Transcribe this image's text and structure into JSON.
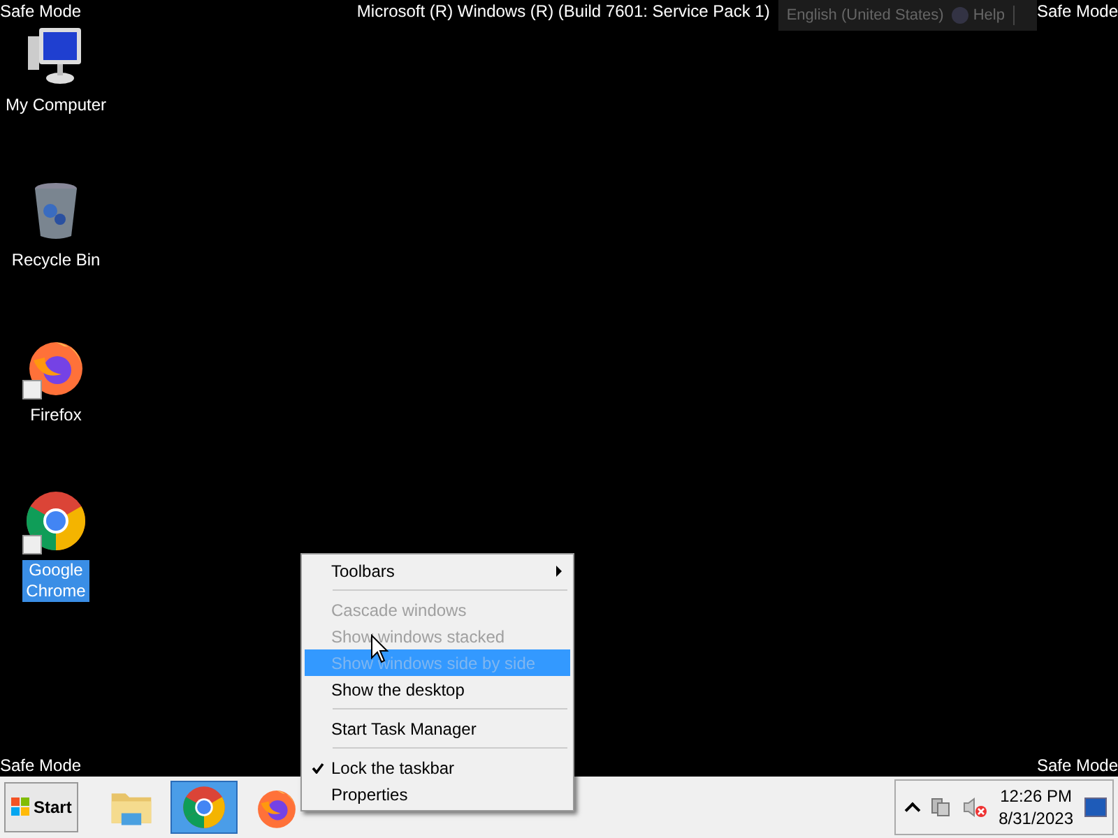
{
  "top_bar": {
    "left_label": "Safe Mode",
    "title": "Microsoft (R) Windows (R) (Build 7601: Service Pack 1)",
    "language": "English (United States)",
    "help": "Help",
    "right_label": "Safe Mode"
  },
  "desktop_icons": [
    {
      "kind": "computer",
      "label": "My Computer",
      "selected": false,
      "shortcut": false
    },
    {
      "kind": "recycle",
      "label": "Recycle Bin",
      "selected": false,
      "shortcut": false
    },
    {
      "kind": "firefox",
      "label": "Firefox",
      "selected": false,
      "shortcut": true
    },
    {
      "kind": "chrome",
      "label": "Google Chrome",
      "selected": true,
      "shortcut": true
    }
  ],
  "bottom_labels": {
    "left": "Safe Mode",
    "right": "Safe Mode"
  },
  "context_menu": [
    {
      "kind": "item",
      "label": "Toolbars",
      "disabled": false,
      "selected": false,
      "checked": false,
      "submenu": true
    },
    {
      "kind": "separator"
    },
    {
      "kind": "item",
      "label": "Cascade windows",
      "disabled": true,
      "selected": false,
      "checked": false,
      "submenu": false
    },
    {
      "kind": "item",
      "label": "Show windows stacked",
      "disabled": true,
      "selected": false,
      "checked": false,
      "submenu": false
    },
    {
      "kind": "item",
      "label": "Show windows side by side",
      "disabled": true,
      "selected": true,
      "checked": false,
      "submenu": false
    },
    {
      "kind": "item",
      "label": "Show the desktop",
      "disabled": false,
      "selected": false,
      "checked": false,
      "submenu": false
    },
    {
      "kind": "separator"
    },
    {
      "kind": "item",
      "label": "Start Task Manager",
      "disabled": false,
      "selected": false,
      "checked": false,
      "submenu": false
    },
    {
      "kind": "separator"
    },
    {
      "kind": "item",
      "label": "Lock the taskbar",
      "disabled": false,
      "selected": false,
      "checked": true,
      "submenu": false
    },
    {
      "kind": "item",
      "label": "Properties",
      "disabled": false,
      "selected": false,
      "checked": false,
      "submenu": false
    }
  ],
  "taskbar": {
    "start": "Start",
    "apps": [
      {
        "kind": "folder",
        "selected": false
      },
      {
        "kind": "chrome",
        "selected": true
      },
      {
        "kind": "firefox",
        "selected": false
      }
    ],
    "clock_time": "12:26 PM",
    "clock_date": "8/31/2023"
  }
}
